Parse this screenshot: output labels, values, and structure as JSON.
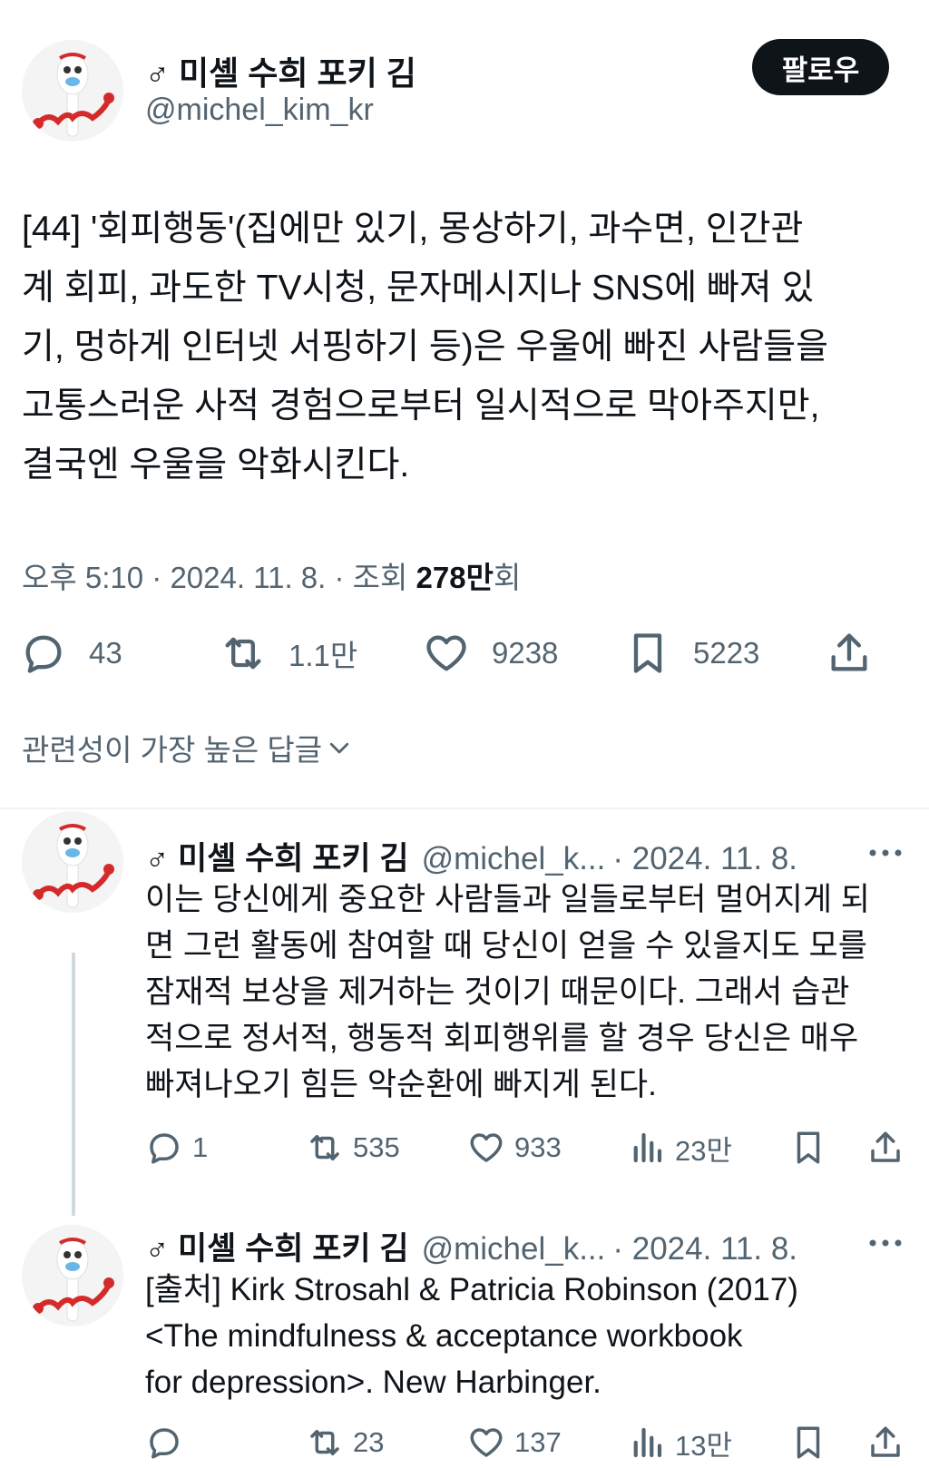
{
  "main_tweet": {
    "display_name": "♂ 미셸 수희 포키 김",
    "handle": "@michel_kim_kr",
    "follow_label": "팔로우",
    "text": "[44] '회피행동'(집에만 있기, 몽상하기, 과수면, 인간관\n계 회피, 과도한 TV시청, 문자메시지나 SNS에 빠져 있\n기, 멍하게 인터넷 서핑하기 등)은 우울에 빠진 사람들을\n고통스러운 사적 경험으로부터 일시적으로 막아주지만,\n결국엔 우울을 악화시킨다.",
    "time": "오후 5:10 · 2024. 11. 8. · 조회 ",
    "views_number": "278만",
    "views_suffix": "회",
    "stats": {
      "replies": "43",
      "reposts": "1.1만",
      "likes": "9238",
      "bookmarks": "5223"
    }
  },
  "replies_sort": {
    "label": "관련성이 가장 높은 답글"
  },
  "replies": [
    {
      "display_name": "♂ 미셸 수희 포키 김",
      "handle": "@michel_k...",
      "date": "· 2024. 11. 8.",
      "text": "이는 당신에게 중요한 사람들과 일들로부터 멀어지게 되\n면 그런 활동에 참여할 때 당신이 얻을 수 있을지도 모를\n잠재적 보상을 제거하는 것이기 때문이다. 그래서 습관\n적으로 정서적, 행동적 회피행위를 할 경우 당신은 매우\n빠져나오기 힘든 악순환에 빠지게 된다.",
      "stats": {
        "replies": "1",
        "reposts": "535",
        "likes": "933",
        "views": "23만"
      }
    },
    {
      "display_name": "♂ 미셸 수희 포키 김",
      "handle": "@michel_k...",
      "date": "· 2024. 11. 8.",
      "text": "[출처] Kirk Strosahl & Patricia Robinson (2017)\n<The mindfulness & acceptance workbook\nfor depression>. New Harbinger.",
      "stats": {
        "replies": "",
        "reposts": "23",
        "likes": "137",
        "views": "13만"
      }
    }
  ],
  "colors": {
    "text_primary": "#0f1419",
    "text_secondary": "#536471",
    "follow_button_bg": "#0f1419",
    "divider": "#eff3f4"
  }
}
